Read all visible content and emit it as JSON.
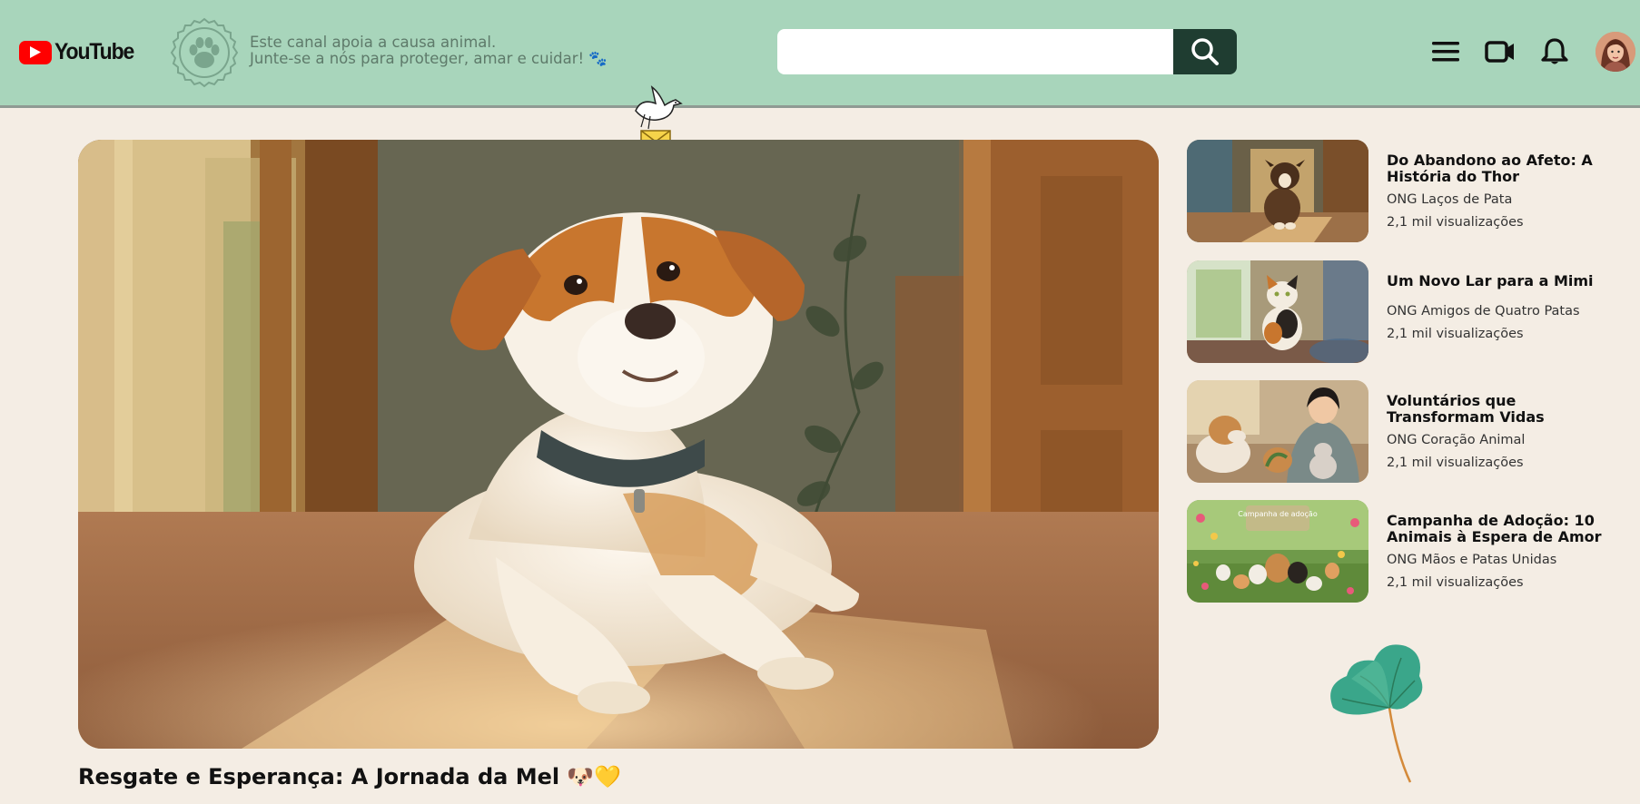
{
  "header": {
    "logo_text": "YouTube",
    "tagline_line1": "Este canal apoia a causa animal.",
    "tagline_line2": "Junte-se a nós para proteger, amar e cuidar! 🐾",
    "search_placeholder": "",
    "search_value": "",
    "background_color": "#a8d5bb",
    "search_button_color": "#1f3d31",
    "icons": [
      "menu-icon",
      "video-camera-icon",
      "bell-icon"
    ]
  },
  "main_video": {
    "title": "Resgate e Esperança: A Jornada da Mel",
    "emoji": "🐶💛"
  },
  "sidebar": {
    "items": [
      {
        "title": "Do Abandono ao Afeto: A História do Thor",
        "channel": "ONG Laços de Pata",
        "views": "2,1 mil visualizações"
      },
      {
        "title": "Um Novo Lar para a Mimi",
        "channel": "ONG Amigos de Quatro Patas",
        "views": "2,1 mil visualizações"
      },
      {
        "title": "Voluntários que Transformam Vidas",
        "channel": "ONG Coração Animal",
        "views": "2,1 mil visualizações"
      },
      {
        "title": "Campanha de Adoção: 10 Animais à Espera de Amor",
        "channel": "ONG Mãos e Patas Unidas",
        "views": "2,1 mil visualizações",
        "thumb_caption": "Campanha de adoção"
      }
    ]
  }
}
